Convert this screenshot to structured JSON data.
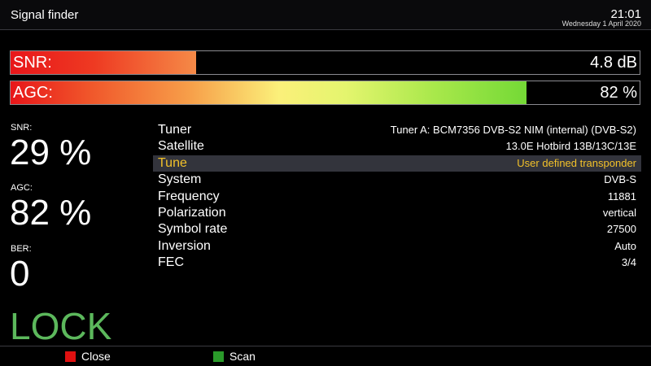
{
  "header": {
    "title": "Signal finder",
    "time": "21:01",
    "date": "Wednesday  1 April 2020"
  },
  "bars": {
    "snr": {
      "label": "SNR:",
      "value": "4.8 dB",
      "fill_fraction": 0.295
    },
    "agc": {
      "label": "AGC:",
      "value": "82 %",
      "fill_fraction": 0.82
    }
  },
  "stats": {
    "snr": {
      "label": "SNR:",
      "value": "29 %"
    },
    "agc": {
      "label": "AGC:",
      "value": "82 %"
    },
    "ber": {
      "label": "BER:",
      "value": "0"
    },
    "lock": "LOCK"
  },
  "info": [
    {
      "key": "Tuner",
      "value": "Tuner A: BCM7356 DVB-S2 NIM (internal) (DVB-S2)"
    },
    {
      "key": "Satellite",
      "value": "13.0E Hotbird 13B/13C/13E"
    },
    {
      "key": "Tune",
      "value": "User defined transponder"
    },
    {
      "key": "System",
      "value": "DVB-S"
    },
    {
      "key": "Frequency",
      "value": "11881"
    },
    {
      "key": "Polarization",
      "value": "vertical"
    },
    {
      "key": "Symbol rate",
      "value": "27500"
    },
    {
      "key": "Inversion",
      "value": "Auto"
    },
    {
      "key": "FEC",
      "value": "3/4"
    }
  ],
  "selected_row": 2,
  "footer": {
    "red_label": "Close",
    "green_label": "Scan",
    "red_color": "#e01010",
    "green_color": "#2a9a2a"
  },
  "colors": {
    "lock": "#5cb85c",
    "highlight_text": "#f2c12a"
  }
}
